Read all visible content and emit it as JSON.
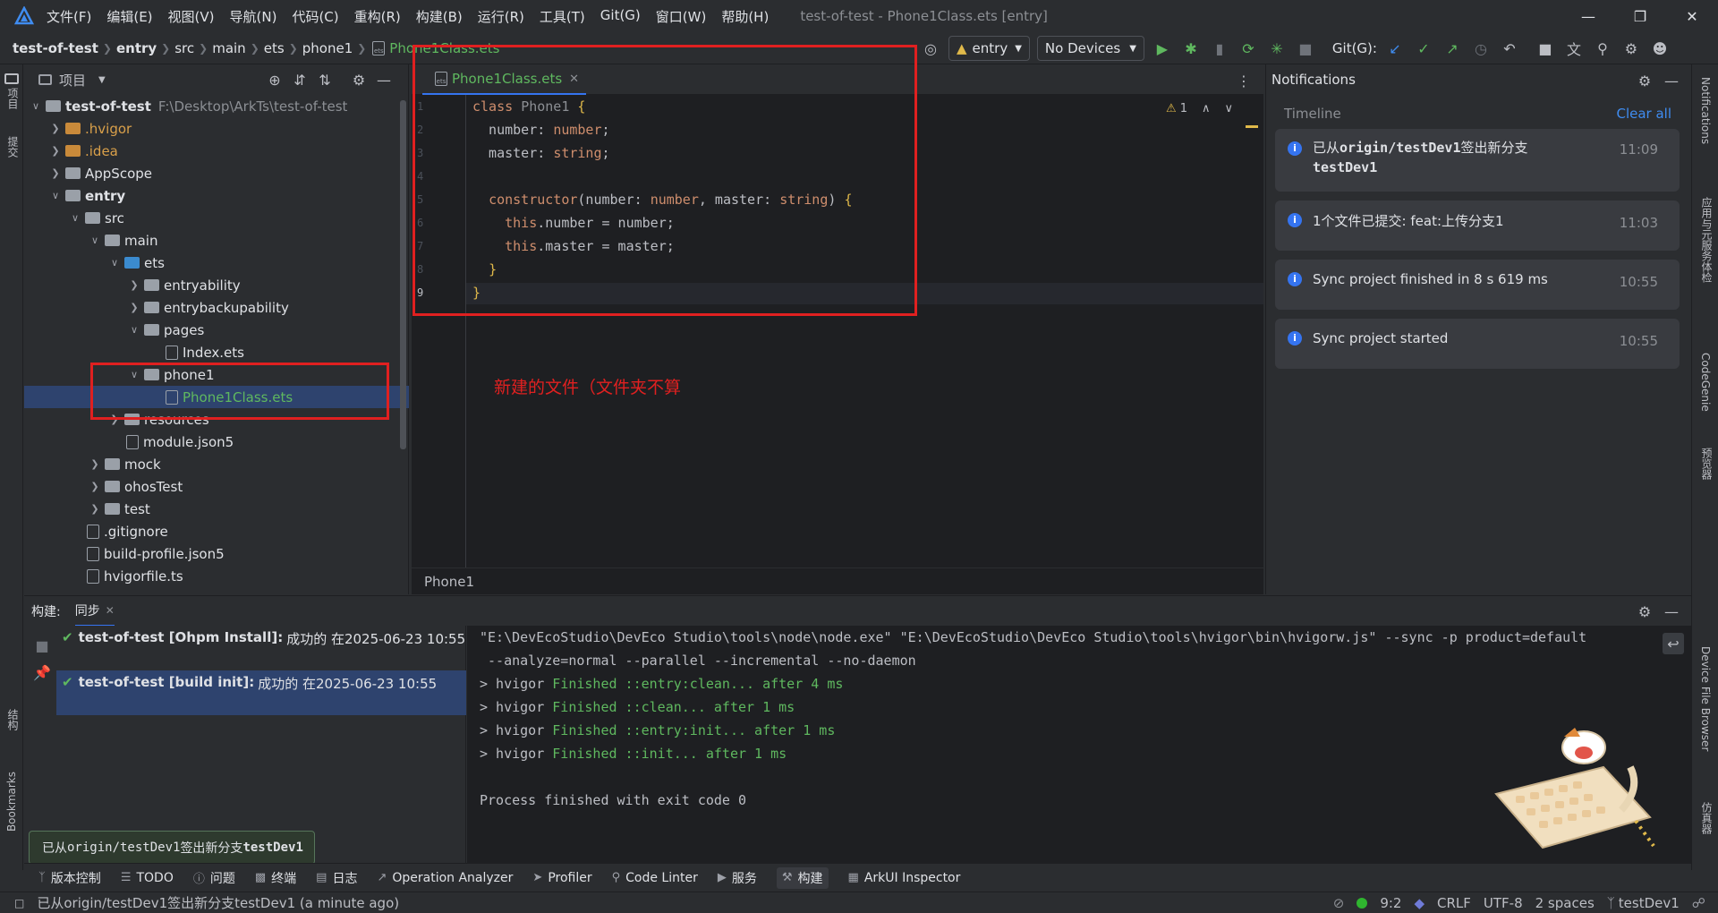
{
  "menu": [
    "文件(F)",
    "编辑(E)",
    "视图(V)",
    "导航(N)",
    "代码(C)",
    "重构(R)",
    "构建(B)",
    "运行(R)",
    "工具(T)",
    "Git(G)",
    "窗口(W)",
    "帮助(H)"
  ],
  "window_title": "test-of-test - Phone1Class.ets [entry]",
  "breadcrumbs": [
    "test-of-test",
    "entry",
    "src",
    "main",
    "ets",
    "phone1",
    "Phone1Class.ets"
  ],
  "toolbar": {
    "module": "entry",
    "devices": "No Devices",
    "git_label": "Git(G):"
  },
  "left_strip": {
    "project": "项目",
    "commit": "提交",
    "structure": "结构",
    "bookmarks": "Bookmarks"
  },
  "project": {
    "title": "项目",
    "root_name": "test-of-test",
    "root_path": "F:\\Desktop\\ArkTs\\test-of-test",
    "items": [
      {
        "label": ".hvigor",
        "kind": "folder-orange",
        "level": 1,
        "arrow": ">"
      },
      {
        "label": ".idea",
        "kind": "folder-orange",
        "level": 1,
        "arrow": ">"
      },
      {
        "label": "AppScope",
        "kind": "folder",
        "level": 1,
        "arrow": ">"
      },
      {
        "label": "entry",
        "kind": "folder",
        "level": 1,
        "arrow": "v",
        "bold": true
      },
      {
        "label": "src",
        "kind": "folder",
        "level": 2,
        "arrow": "v"
      },
      {
        "label": "main",
        "kind": "folder",
        "level": 3,
        "arrow": "v"
      },
      {
        "label": "ets",
        "kind": "folder-blue",
        "level": 4,
        "arrow": "v"
      },
      {
        "label": "entryability",
        "kind": "folder",
        "level": 5,
        "arrow": ">"
      },
      {
        "label": "entrybackupability",
        "kind": "folder",
        "level": 5,
        "arrow": ">"
      },
      {
        "label": "pages",
        "kind": "folder",
        "level": 5,
        "arrow": "v"
      },
      {
        "label": "Index.ets",
        "kind": "file",
        "level": 6,
        "arrow": ""
      },
      {
        "label": "phone1",
        "kind": "folder",
        "level": 5,
        "arrow": "v"
      },
      {
        "label": "Phone1Class.ets",
        "kind": "file",
        "level": 6,
        "arrow": "",
        "selected": true
      },
      {
        "label": "resources",
        "kind": "folder",
        "level": 4,
        "arrow": ">"
      },
      {
        "label": "module.json5",
        "kind": "file",
        "level": 4,
        "arrow": ""
      },
      {
        "label": "mock",
        "kind": "folder",
        "level": 3,
        "arrow": ">"
      },
      {
        "label": "ohosTest",
        "kind": "folder",
        "level": 3,
        "arrow": ">"
      },
      {
        "label": "test",
        "kind": "folder",
        "level": 3,
        "arrow": ">"
      },
      {
        "label": ".gitignore",
        "kind": "file",
        "level": 2,
        "arrow": ""
      },
      {
        "label": "build-profile.json5",
        "kind": "file",
        "level": 2,
        "arrow": ""
      },
      {
        "label": "hvigorfile.ts",
        "kind": "file",
        "level": 2,
        "arrow": ""
      }
    ]
  },
  "editor": {
    "tab": "Phone1Class.ets",
    "warning_count": "1",
    "breadcrumb": "Phone1",
    "lines": [
      "1",
      "2",
      "3",
      "4",
      "5",
      "6",
      "7",
      "8",
      "9"
    ]
  },
  "annotation": "新建的文件（文件夹不算",
  "notifications": {
    "title": "Notifications",
    "timeline": "Timeline",
    "clear_all": "Clear all",
    "items": [
      {
        "text1": "已从",
        "mono": "origin/testDev1",
        "text2": "签出新分支",
        "mono2": "testDev1",
        "time": "11:09"
      },
      {
        "text": "1个文件已提交: feat:上传分支1",
        "time": "11:03"
      },
      {
        "text": "Sync project finished in 8 s 619 ms",
        "time": "10:55"
      },
      {
        "text": "Sync project started",
        "time": "10:55"
      }
    ]
  },
  "right_strip": {
    "notifications": "Notifications",
    "app_service": "应用与元服务体检",
    "codegenie": "CodeGenie",
    "previewer": "预览器",
    "device_file_browser": "Device File Browser",
    "emulator": "仿真器"
  },
  "build": {
    "label": "构建:",
    "tab": "同步",
    "tasks": [
      {
        "name": "test-of-test [Ohpm Install]:",
        "status": "成功的 在2025-06-23 10:55"
      },
      {
        "name": "test-of-test [build init]:",
        "status": "成功的 在2025-06-23 10:55"
      }
    ],
    "console": {
      "cmd1": "\"E:\\DevEcoStudio\\DevEco Studio\\tools\\node\\node.exe\" \"E:\\DevEcoStudio\\DevEco Studio\\tools\\hvigor\\bin\\hvigorw.js\" --sync -p product=default",
      "cmd2": " --analyze=normal --parallel --incremental --no-daemon",
      "lines": [
        {
          "prefix": "> hvigor ",
          "green": "Finished ::entry:clean... after 4 ms"
        },
        {
          "prefix": "> hvigor ",
          "green": "Finished ::clean... after 1 ms"
        },
        {
          "prefix": "> hvigor ",
          "green": "Finished ::entry:init... after 1 ms"
        },
        {
          "prefix": "> hvigor ",
          "green": "Finished ::init... after 1 ms"
        }
      ],
      "exit": "Process finished with exit code 0"
    }
  },
  "toast": {
    "text1": "已从",
    "mono": "origin/testDev1",
    "text2": "签出新分支",
    "mono2": "testDev1"
  },
  "bottom_tools": [
    "版本控制",
    "TODO",
    "问题",
    "终端",
    "日志",
    "Operation Analyzer",
    "Profiler",
    "Code Linter",
    "服务",
    "构建",
    "ArkUI Inspector"
  ],
  "status": {
    "message": "已从origin/testDev1签出新分支testDev1 (a minute ago)",
    "position": "9:2",
    "line_sep": "CRLF",
    "encoding": "UTF-8",
    "indent": "2 spaces",
    "branch": "testDev1"
  },
  "colors": {
    "accent": "#3574f0",
    "annotation_red": "#e02020",
    "success_green": "#5fb85f",
    "selected_row": "#2e436e"
  }
}
